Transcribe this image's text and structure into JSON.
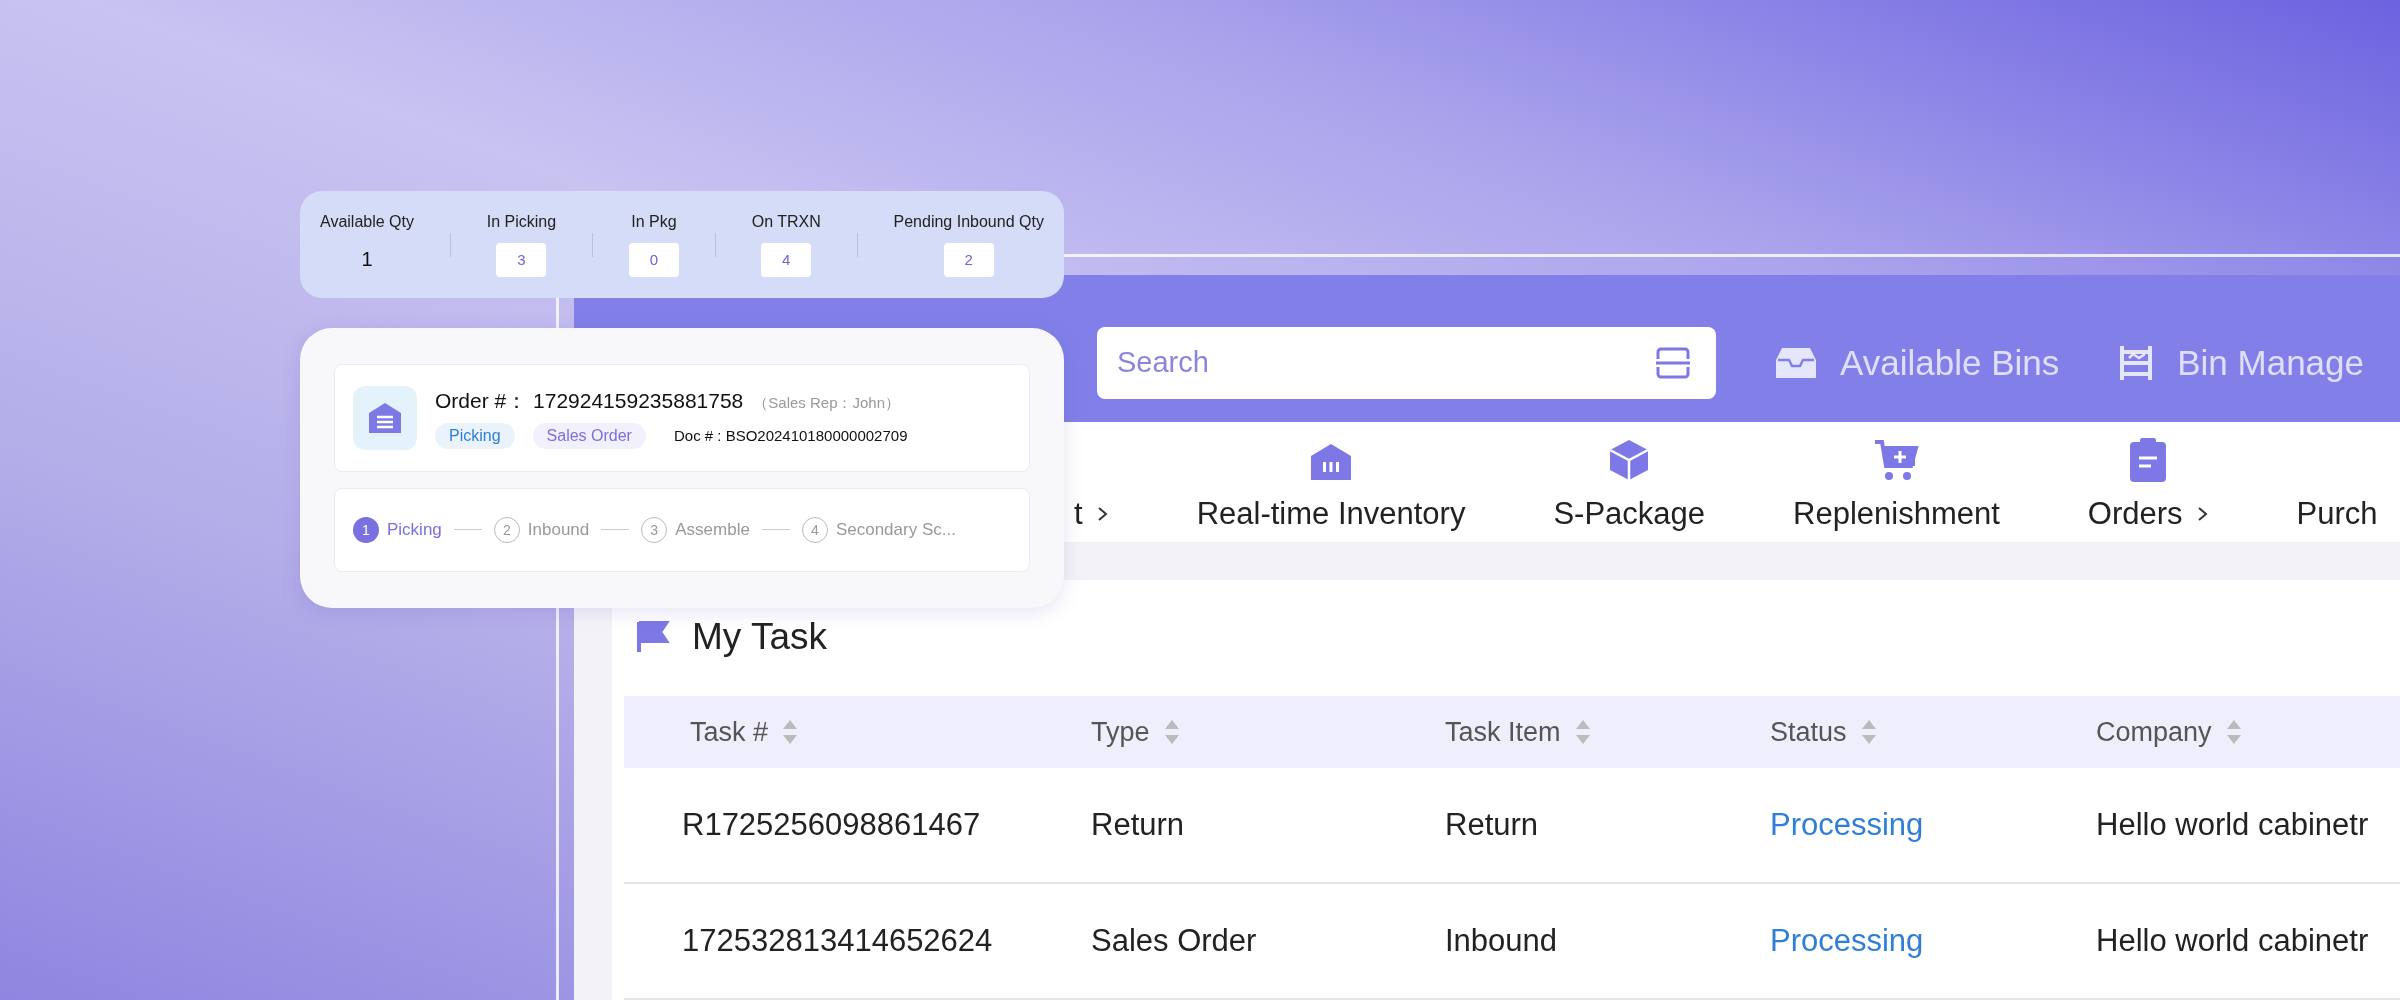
{
  "stats": [
    {
      "label": "Available Qty",
      "value": "1",
      "kind": "plain"
    },
    {
      "label": "In Picking",
      "value": "3",
      "kind": "boxed"
    },
    {
      "label": "In Pkg",
      "value": "0",
      "kind": "boxed"
    },
    {
      "label": "On TRXN",
      "value": "4",
      "kind": "boxed"
    },
    {
      "label": "Pending Inbound Qty",
      "value": "2",
      "kind": "boxed"
    }
  ],
  "order": {
    "label": "Order #：",
    "number": "172924159235881758",
    "rep": "（Sales Rep：John）",
    "doc": "Doc # : BSO202410180000002709",
    "tags": [
      {
        "label": "Picking",
        "color": "#2f7fd8"
      },
      {
        "label": "Sales Order",
        "color": "#7b6fe0"
      }
    ]
  },
  "steps": [
    {
      "number": "1",
      "label": "Picking",
      "selected": true
    },
    {
      "number": "2",
      "label": "Inbound",
      "selected": false
    },
    {
      "number": "3",
      "label": "Assemble",
      "selected": false
    },
    {
      "number": "4",
      "label": "Secondary Sc...",
      "selected": false
    }
  ],
  "header": {
    "search_placeholder": "Search",
    "links": [
      {
        "label": "Available Bins",
        "kind": "bins"
      },
      {
        "label": "Bin Manage",
        "kind": "manager"
      }
    ]
  },
  "nav": [
    {
      "label": "t",
      "more": true
    },
    {
      "label": "Real-time Inventory",
      "more": false
    },
    {
      "label": "S-Package",
      "more": false
    },
    {
      "label": "Replenishment",
      "more": false
    },
    {
      "label": "Orders",
      "more": true
    },
    {
      "label": "Purch",
      "more": false
    }
  ],
  "task": {
    "title": "My Task",
    "columns": [
      {
        "label": "Task #",
        "kind": "text"
      },
      {
        "label": "Type",
        "kind": "text"
      },
      {
        "label": "Task Item",
        "kind": "text"
      },
      {
        "label": "Status",
        "kind": "status"
      },
      {
        "label": "Company",
        "kind": "text"
      }
    ],
    "rows": [
      [
        "R1725256098861467",
        "Return",
        "Return",
        "Processing",
        "Hello world cabinetr"
      ],
      [
        "172532813414652624",
        "Sales Order",
        "Inbound",
        "Processing",
        "Hello world cabinetr"
      ]
    ]
  }
}
